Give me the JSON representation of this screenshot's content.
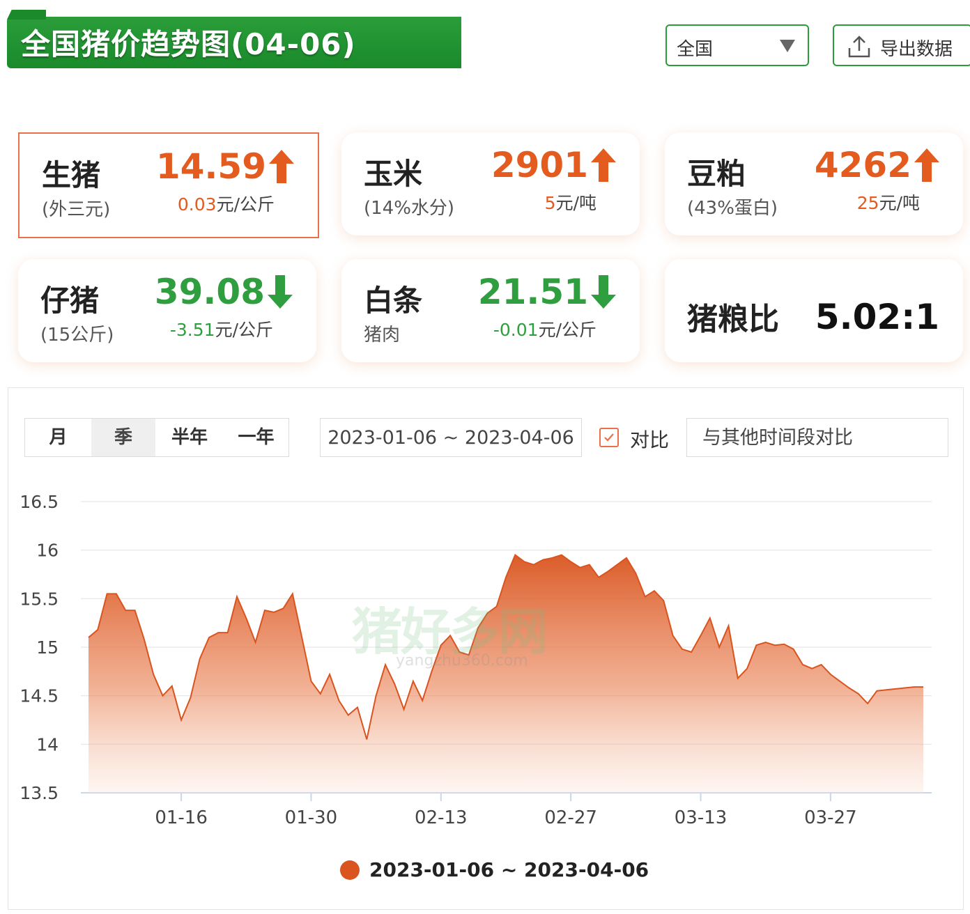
{
  "header": {
    "title": "全国猪价趋势图(04-06)",
    "region": "全国",
    "export_label": "导出数据"
  },
  "cards": [
    {
      "name": "生猪",
      "sub": "(外三元)",
      "value": "14.59",
      "change": "0.03",
      "unit": "元/公斤",
      "dir": "up"
    },
    {
      "name": "玉米",
      "sub": "(14%水分)",
      "value": "2901",
      "change": "5",
      "unit": "元/吨",
      "dir": "up"
    },
    {
      "name": "豆粕",
      "sub": "(43%蛋白)",
      "value": "4262",
      "change": "25",
      "unit": "元/吨",
      "dir": "up"
    },
    {
      "name": "仔猪",
      "sub": "(15公斤)",
      "value": "39.08",
      "change": "-3.51",
      "unit": "元/公斤",
      "dir": "down"
    },
    {
      "name": "白条",
      "sub": "猪肉",
      "value": "21.51",
      "change": "-0.01",
      "unit": "元/公斤",
      "dir": "down"
    },
    {
      "name": "猪粮比",
      "value": "5.02:1"
    }
  ],
  "controls": {
    "tabs": [
      "月",
      "季",
      "半年",
      "一年"
    ],
    "active_tab": "季",
    "date_range": "2023-01-06 ~ 2023-04-06",
    "compare_label": "对比",
    "compare_placeholder": "与其他时间段对比"
  },
  "watermark": {
    "text": "猪好多网",
    "url": "yangzhu360.com"
  },
  "colors": {
    "brand_green": "#2a9d3a",
    "up": "#e35b1e",
    "down": "#2e9e3e",
    "series": "#d9541e"
  },
  "chart_data": {
    "type": "area",
    "ylim": [
      13.5,
      16.5
    ],
    "yticks": [
      "16.5",
      "16",
      "15.5",
      "15",
      "14.5",
      "14",
      "13.5"
    ],
    "xticks": [
      "01-16",
      "01-30",
      "02-13",
      "02-27",
      "03-13",
      "03-27"
    ],
    "series": [
      {
        "name": "2023-01-06 ~ 2023-04-06",
        "x": [
          "01-06",
          "01-07",
          "01-08",
          "01-09",
          "01-10",
          "01-11",
          "01-12",
          "01-13",
          "01-14",
          "01-15",
          "01-16",
          "01-17",
          "01-18",
          "01-19",
          "01-20",
          "01-21",
          "01-22",
          "01-23",
          "01-24",
          "01-25",
          "01-26",
          "01-27",
          "01-28",
          "01-29",
          "01-30",
          "01-31",
          "02-01",
          "02-02",
          "02-03",
          "02-04",
          "02-05",
          "02-06",
          "02-07",
          "02-08",
          "02-09",
          "02-10",
          "02-11",
          "02-12",
          "02-13",
          "02-14",
          "02-15",
          "02-16",
          "02-17",
          "02-18",
          "02-19",
          "02-20",
          "02-21",
          "02-22",
          "02-23",
          "02-24",
          "02-25",
          "02-26",
          "02-27",
          "02-28",
          "03-01",
          "03-02",
          "03-03",
          "03-04",
          "03-05",
          "03-06",
          "03-07",
          "03-08",
          "03-09",
          "03-10",
          "03-11",
          "03-12",
          "03-13",
          "03-14",
          "03-15",
          "03-16",
          "03-17",
          "03-18",
          "03-19",
          "03-20",
          "03-21",
          "03-22",
          "03-23",
          "03-24",
          "03-25",
          "03-26",
          "03-27",
          "03-28",
          "03-29",
          "03-30",
          "03-31",
          "04-01",
          "04-02",
          "04-03",
          "04-04",
          "04-05",
          "04-06"
        ],
        "values": [
          15.1,
          15.18,
          15.55,
          15.55,
          15.38,
          15.38,
          15.08,
          14.72,
          14.5,
          14.6,
          14.25,
          14.48,
          14.88,
          15.1,
          15.15,
          15.15,
          15.52,
          15.3,
          15.05,
          15.38,
          15.36,
          15.4,
          15.55,
          15.1,
          14.65,
          14.52,
          14.72,
          14.45,
          14.3,
          14.38,
          14.05,
          14.5,
          14.82,
          14.62,
          14.36,
          14.65,
          14.45,
          14.75,
          15.02,
          15.12,
          14.95,
          14.92,
          15.2,
          15.35,
          15.42,
          15.72,
          15.95,
          15.88,
          15.85,
          15.9,
          15.92,
          15.95,
          15.88,
          15.82,
          15.85,
          15.72,
          15.78,
          15.85,
          15.92,
          15.76,
          15.52,
          15.58,
          15.48,
          15.12,
          14.98,
          14.95,
          15.12,
          15.3,
          15.0,
          15.22,
          14.68,
          14.78,
          15.02,
          15.05,
          15.02,
          15.03,
          14.98,
          14.82,
          14.78,
          14.82,
          14.72,
          14.65,
          14.58,
          14.52,
          14.42,
          14.55,
          14.56,
          14.57,
          14.58,
          14.59,
          14.59
        ]
      }
    ],
    "legend": "bottom-center",
    "grid": true
  }
}
